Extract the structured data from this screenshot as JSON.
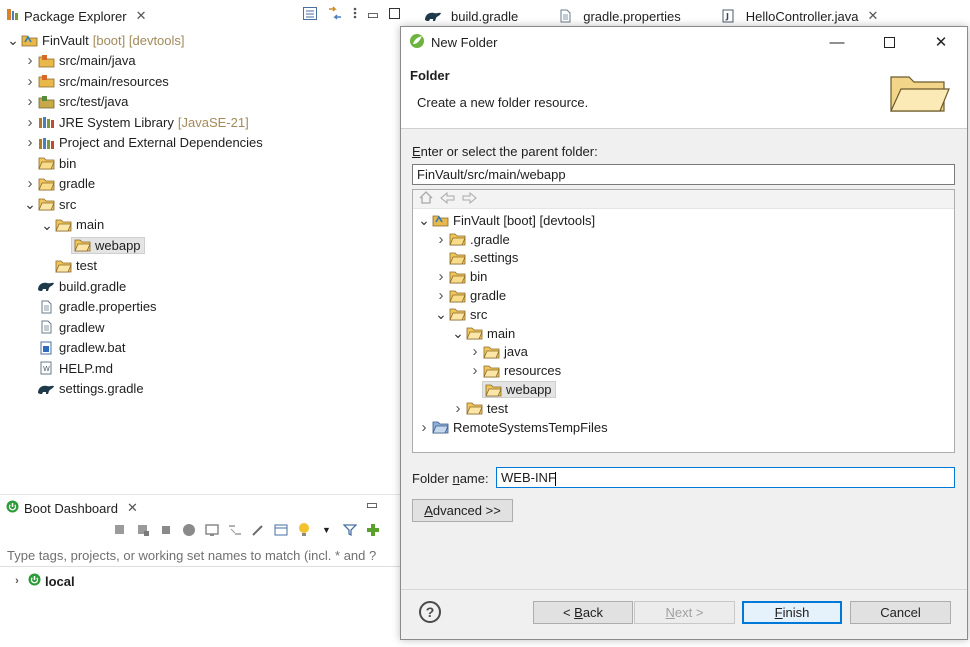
{
  "package_explorer": {
    "title": "Package Explorer",
    "items": [
      {
        "label": "FinVault",
        "suffix": "[boot] [devtools]",
        "icon": "project-icon",
        "arrow": "open",
        "indent": 0
      },
      {
        "label": "src/main/java",
        "suffix": "",
        "icon": "source-folder-icon",
        "arrow": "closed",
        "indent": 1
      },
      {
        "label": "src/main/resources",
        "suffix": "",
        "icon": "source-folder-icon",
        "arrow": "closed",
        "indent": 1
      },
      {
        "label": "src/test/java",
        "suffix": "",
        "icon": "source-folder-test-icon",
        "arrow": "closed",
        "indent": 1
      },
      {
        "label": "JRE System Library",
        "suffix": "[JavaSE-21]",
        "icon": "library-icon",
        "arrow": "closed",
        "indent": 1
      },
      {
        "label": "Project and External Dependencies",
        "suffix": "",
        "icon": "library-icon",
        "arrow": "closed",
        "indent": 1
      },
      {
        "label": "bin",
        "suffix": "",
        "icon": "folder-icon",
        "arrow": "none",
        "indent": 1
      },
      {
        "label": "gradle",
        "suffix": "",
        "icon": "folder-icon",
        "arrow": "closed",
        "indent": 1
      },
      {
        "label": "src",
        "suffix": "",
        "icon": "folder-open-icon",
        "arrow": "open",
        "indent": 1
      },
      {
        "label": "main",
        "suffix": "",
        "icon": "folder-open-icon",
        "arrow": "open",
        "indent": 2
      },
      {
        "label": "webapp",
        "suffix": "",
        "icon": "folder-open-icon",
        "arrow": "none",
        "indent": 3,
        "selected": true
      },
      {
        "label": "test",
        "suffix": "",
        "icon": "folder-open-icon",
        "arrow": "none",
        "indent": 2
      },
      {
        "label": "build.gradle",
        "suffix": "",
        "icon": "gradle-icon",
        "arrow": "none",
        "indent": 1
      },
      {
        "label": "gradle.properties",
        "suffix": "",
        "icon": "file-icon",
        "arrow": "none",
        "indent": 1
      },
      {
        "label": "gradlew",
        "suffix": "",
        "icon": "file-icon",
        "arrow": "none",
        "indent": 1
      },
      {
        "label": "gradlew.bat",
        "suffix": "",
        "icon": "bat-file-icon",
        "arrow": "none",
        "indent": 1
      },
      {
        "label": "HELP.md",
        "suffix": "",
        "icon": "md-file-icon",
        "arrow": "none",
        "indent": 1
      },
      {
        "label": "settings.gradle",
        "suffix": "",
        "icon": "gradle-icon",
        "arrow": "none",
        "indent": 1
      }
    ]
  },
  "boot_dashboard": {
    "title": "Boot Dashboard",
    "filter_placeholder": "Type tags, projects, or working set names to match (incl. * and ?",
    "local_label": "local"
  },
  "editor_tabs": [
    {
      "label": "build.gradle",
      "icon": "gradle-icon"
    },
    {
      "label": "gradle.properties",
      "icon": "file-icon"
    },
    {
      "label": "HelloController.java",
      "icon": "java-file-icon"
    }
  ],
  "dialog": {
    "window_title": "New Folder",
    "banner_title": "Folder",
    "banner_description": "Create a new folder resource.",
    "parent_label_accel": "E",
    "parent_label_rest": "nter or select the parent folder:",
    "parent_value": "FinVault/src/main/webapp",
    "tree": [
      {
        "label": "FinVault [boot] [devtools]",
        "icon": "project-icon",
        "arrow": "open",
        "indent": 0
      },
      {
        "label": ".gradle",
        "icon": "folder-icon",
        "arrow": "closed",
        "indent": 1
      },
      {
        "label": ".settings",
        "icon": "folder-icon",
        "arrow": "none",
        "indent": 1
      },
      {
        "label": "bin",
        "icon": "folder-icon",
        "arrow": "closed",
        "indent": 1
      },
      {
        "label": "gradle",
        "icon": "folder-icon",
        "arrow": "closed",
        "indent": 1
      },
      {
        "label": "src",
        "icon": "folder-open-icon",
        "arrow": "open",
        "indent": 1
      },
      {
        "label": "main",
        "icon": "folder-open-icon",
        "arrow": "open",
        "indent": 2
      },
      {
        "label": "java",
        "icon": "folder-open-icon",
        "arrow": "closed",
        "indent": 3
      },
      {
        "label": "resources",
        "icon": "folder-open-icon",
        "arrow": "closed",
        "indent": 3
      },
      {
        "label": "webapp",
        "icon": "folder-open-icon",
        "arrow": "none",
        "indent": 3,
        "selected": true
      },
      {
        "label": "test",
        "icon": "folder-open-icon",
        "arrow": "closed",
        "indent": 2
      },
      {
        "label": "RemoteSystemsTempFiles",
        "icon": "folder-project-icon",
        "arrow": "closed",
        "indent": 0
      }
    ],
    "folder_name_pre": "Folder ",
    "folder_name_accel": "n",
    "folder_name_post": "ame:",
    "folder_name_value": "WEB-INF",
    "advanced_accel": "A",
    "advanced_rest": "dvanced >>",
    "buttons": {
      "back_pre": "< ",
      "back_accel": "B",
      "back_rest": "ack",
      "next_accel": "N",
      "next_rest": "ext >",
      "finish_accel": "F",
      "finish_rest": "inish",
      "cancel": "Cancel"
    }
  },
  "colors": {
    "accent": "#0078d7",
    "decoration": "#a28a5a",
    "folder": "#e8b84a",
    "boot_green": "#2e9b3a"
  }
}
